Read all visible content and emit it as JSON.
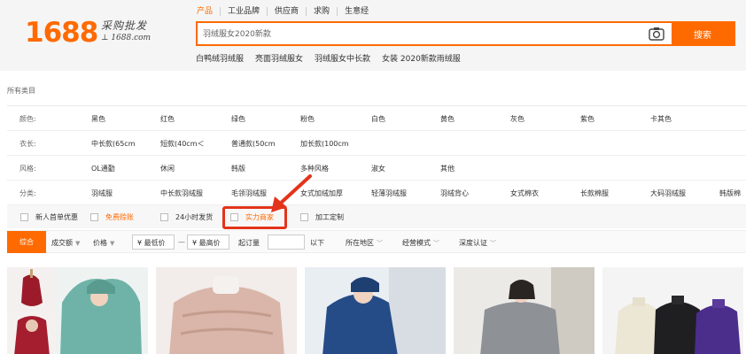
{
  "header": {
    "logo_num": "1688",
    "logo_cn": "采购批发",
    "logo_url": "1688.com",
    "nav": [
      {
        "label": "产品",
        "active": true
      },
      {
        "label": "工业品牌"
      },
      {
        "label": "供应商"
      },
      {
        "label": "求购"
      },
      {
        "label": "生意经"
      }
    ],
    "search_value": "羽绒服女2020新款",
    "search_button": "搜索",
    "hotwords": [
      "白鸭绒羽绒服",
      "亮面羽绒服女",
      "羽绒服女中长款",
      "女装 2020新款雨绒服"
    ]
  },
  "filters": {
    "all_categories": "所有类目",
    "rows": [
      {
        "label": "颜色:",
        "values": [
          "黑色",
          "红色",
          "绿色",
          "粉色",
          "白色",
          "黄色",
          "灰色",
          "紫色",
          "卡其色"
        ]
      },
      {
        "label": "衣长:",
        "values": [
          "中长款(65cm",
          "短款(40cm＜",
          "普通款(50cm",
          "加长款(100cm"
        ]
      },
      {
        "label": "风格:",
        "values": [
          "OL通勤",
          "休闲",
          "韩版",
          "多种风格",
          "淑女",
          "其他"
        ]
      },
      {
        "label": "分类:",
        "values": [
          "羽绒服",
          "中长款羽绒服",
          "毛领羽绒服",
          "女式加绒加厚",
          "轻薄羽绒服",
          "羽绒背心",
          "女式棉衣",
          "长款棉服",
          "大码羽绒服",
          "韩版棉"
        ]
      }
    ],
    "checkboxes": [
      {
        "label": "新人首单优惠",
        "highlight": false
      },
      {
        "label": "免费赊账",
        "highlight": true
      },
      {
        "label": "24小时发货",
        "highlight": false
      },
      {
        "label": "实力商家",
        "highlight": true
      },
      {
        "label": "加工定制",
        "highlight": false
      }
    ]
  },
  "sortbar": {
    "active": "综合",
    "sales": "成交额",
    "price": "价格",
    "min_price": "¥ 最低价",
    "max_price": "¥ 最高价",
    "dash": "—",
    "min_qty": "起订量",
    "below": "以下",
    "region": "所在地区",
    "mode": "经营模式",
    "cert": "深度认证"
  },
  "colors": {
    "brand": "#ff6a00",
    "highlight_red": "#e3341b"
  }
}
